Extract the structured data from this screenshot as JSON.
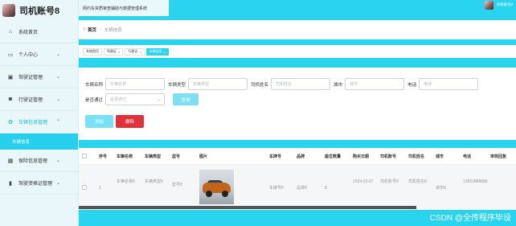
{
  "sidebar": {
    "brand_title": "司机账号8",
    "items": [
      {
        "label": "系统首页",
        "icon": "home-icon",
        "has_chevron": false
      },
      {
        "label": "个人中心",
        "icon": "id-card-icon",
        "has_chevron": true
      },
      {
        "label": "驾驶证管理",
        "icon": "folder-icon",
        "has_chevron": true
      },
      {
        "label": "行驶证管理",
        "icon": "lock-icon",
        "has_chevron": true
      },
      {
        "label": "车辆信息管理",
        "icon": "gear-icon",
        "has_chevron": true,
        "open": true
      },
      {
        "label": "保险信息管理",
        "icon": "grid-icon",
        "has_chevron": true
      },
      {
        "label": "驾驶资格证管理",
        "icon": "chart-icon",
        "has_chevron": true
      }
    ],
    "submenu_active": "车辆信息"
  },
  "topbar": {
    "system_title": "网约车资质审查辅助与数据管理系统",
    "username": "司机账号8"
  },
  "breadcrumb": {
    "home": "首页",
    "current": "车辆信息"
  },
  "tabs": [
    {
      "label": "系统首页",
      "closable": false,
      "active": false
    },
    {
      "label": "驾驶证",
      "closable": true,
      "active": false
    },
    {
      "label": "行驶证",
      "closable": true,
      "active": false
    },
    {
      "label": "车辆信息",
      "closable": true,
      "active": true
    }
  ],
  "search": {
    "fields": [
      {
        "label": "车辆名称",
        "placeholder": "车辆名称"
      },
      {
        "label": "车辆类型",
        "placeholder": "车辆类型"
      },
      {
        "label": "司机姓名",
        "placeholder": "司机姓名"
      },
      {
        "label": "城市",
        "placeholder": "城市"
      },
      {
        "label": "电话",
        "placeholder": "电话"
      }
    ],
    "passed_label": "是否通过",
    "passed_placeholder": "是否通过",
    "search_button": "查询"
  },
  "actions": {
    "add": "添加",
    "delete": "删除"
  },
  "table": {
    "headers": [
      "序号",
      "车辆名称",
      "车辆类型",
      "型号",
      "图片",
      "车牌号",
      "品牌",
      "座位数量",
      "购买日期",
      "司机账号",
      "司机姓名",
      "城市",
      "电话",
      "审核回复"
    ],
    "rows": [
      {
        "index": "1",
        "name": "车辆名称8",
        "type": "车辆类型8",
        "model": "型号8",
        "image": "car-photo",
        "plate": "车牌号8",
        "brand": "品牌8",
        "seats": "8",
        "date": "2024-03-07",
        "account": "司机账号8",
        "driver": "司机姓名8",
        "city": "城市8",
        "phone": "13823888888",
        "reply": ""
      }
    ]
  },
  "watermark": "CSDN @全传程序毕设"
}
